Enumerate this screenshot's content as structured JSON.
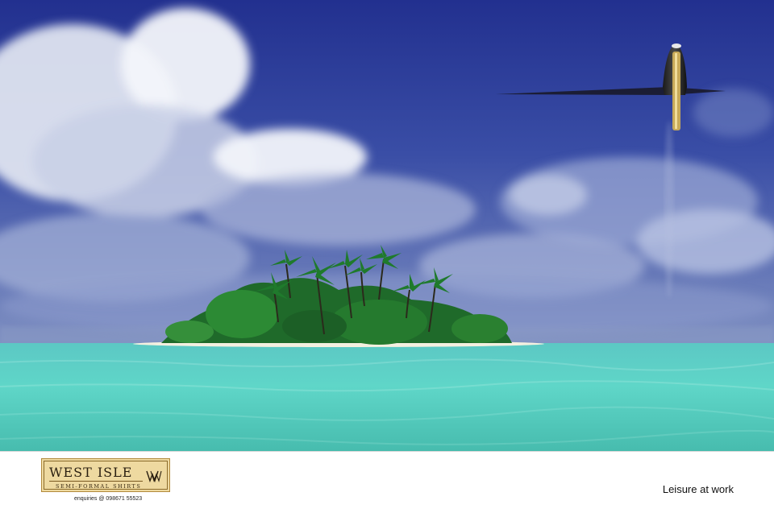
{
  "brand": {
    "name": "WEST ISLE",
    "subtitle": "SEMI-FORMAL SHIRTS",
    "enquiries": "enquiries @ 098671 55523",
    "logo_colors": {
      "background": "#eed9a0",
      "border": "#b28a3c"
    }
  },
  "tagline": "Leisure at work",
  "colors": {
    "sky": "#2f3f9f",
    "sea": "#5fd6c8",
    "footer": "#ffffff"
  },
  "icons": {
    "emblem": "ww-monogram-icon",
    "pen": "fountain-pen-icon"
  }
}
